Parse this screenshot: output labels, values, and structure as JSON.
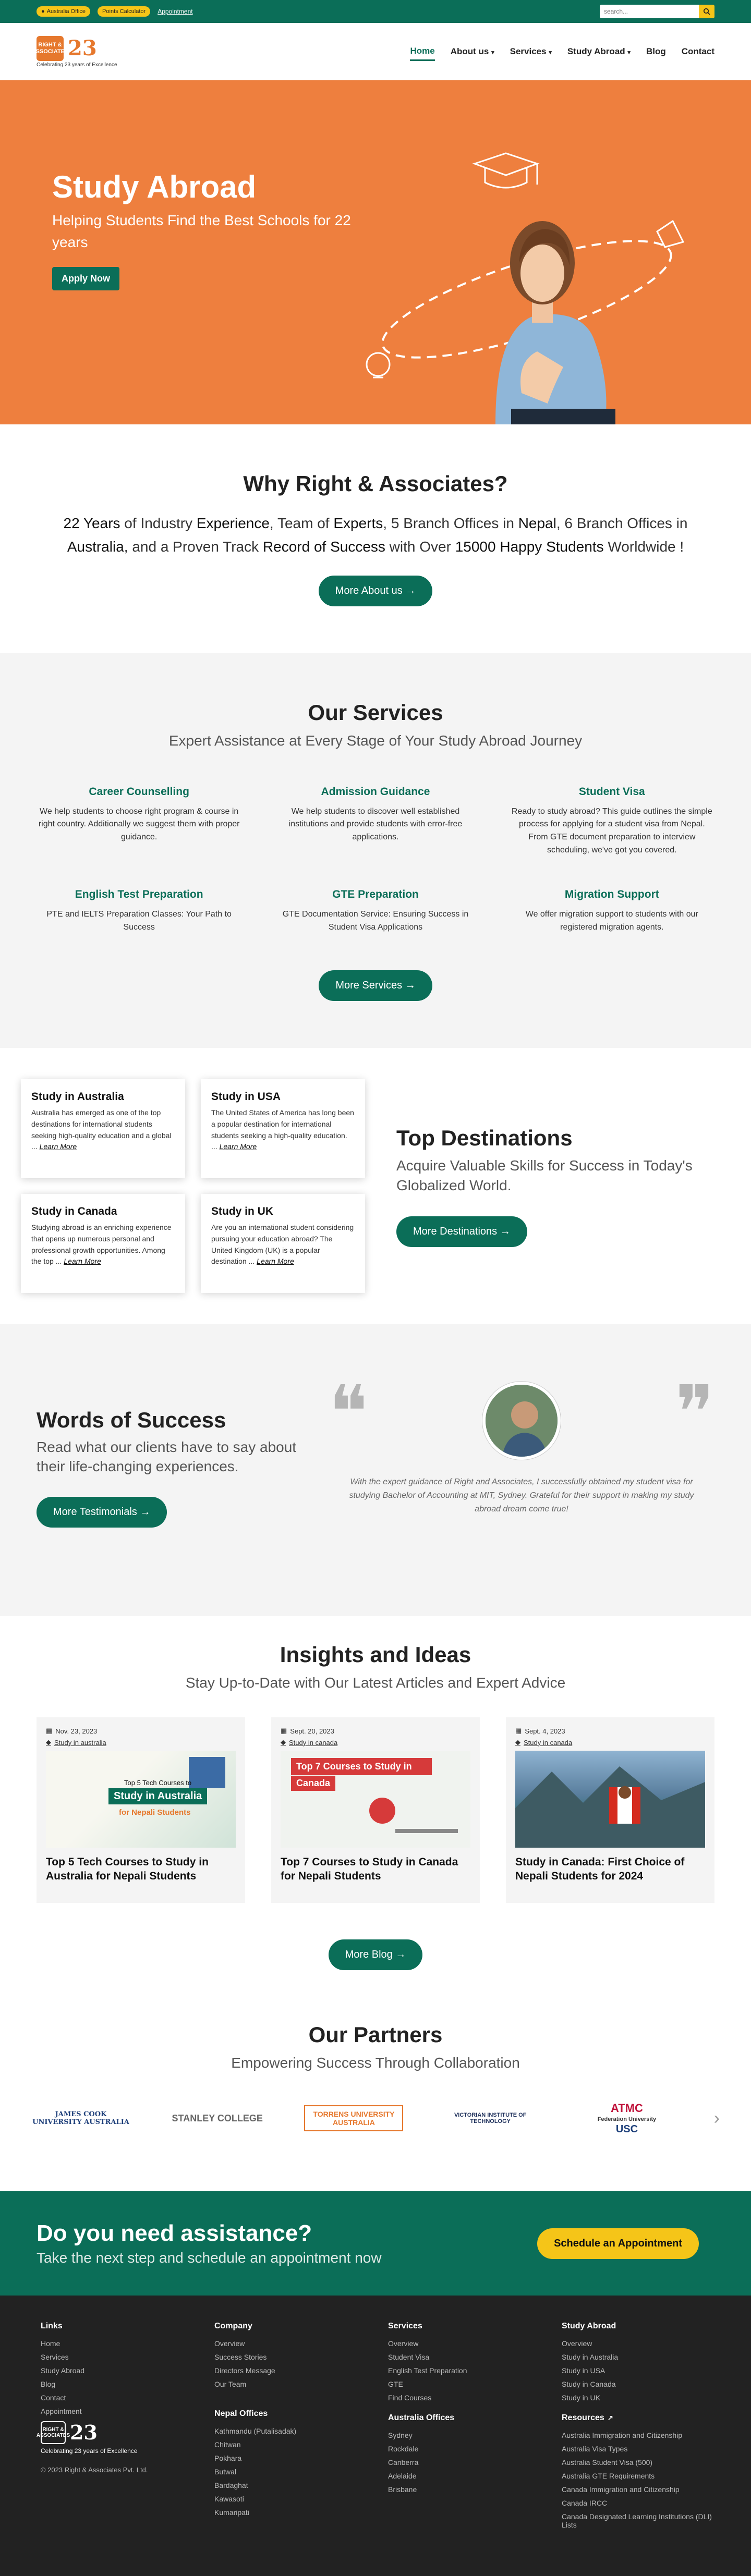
{
  "topbar": {
    "office_label": "Australia Office",
    "calculator_label": "Points Calculator",
    "appointment_label": "Appointment",
    "search_placeholder": "search..."
  },
  "brand": {
    "name": "RIGHT & ASSOCIATES",
    "years": "23",
    "tagline": "Celebrating 23 years of Excellence"
  },
  "nav": {
    "items": [
      "Home",
      "About us",
      "Services",
      "Study Abroad",
      "Blog",
      "Contact"
    ],
    "dropdown_indicators": [
      "",
      "▾",
      "▾",
      "▾",
      "",
      ""
    ]
  },
  "hero": {
    "title": "Study Abroad",
    "subtitle": "Helping Students Find the Best Schools for 22 years",
    "cta": "Apply Now"
  },
  "why": {
    "title": "Why Right & Associates?",
    "text_parts": [
      "22 Years",
      " of Industry ",
      "Experience",
      ", Team of ",
      "Experts",
      ", 5 Branch Offices in ",
      "Nepal",
      ", 6 Branch Offices in ",
      "Australia",
      ", and a Proven Track ",
      "Record of Success",
      " with Over ",
      "15000 Happy Students",
      " Worldwide !"
    ],
    "cta": "More About us"
  },
  "services": {
    "title": "Our Services",
    "subtitle": "Expert Assistance at Every Stage of Your Study Abroad Journey",
    "items": [
      {
        "title": "Career Counselling",
        "text": "We help students to choose right program & course in right country. Additionally we suggest them with proper guidance."
      },
      {
        "title": "Admission Guidance",
        "text": "We help students to discover well established institutions and provide students with error-free applications."
      },
      {
        "title": "Student Visa",
        "text": "Ready to study abroad? This guide outlines the simple process for applying for a student visa from Nepal. From GTE document preparation to interview scheduling, we've got you covered."
      },
      {
        "title": "English Test Preparation",
        "text": "PTE and IELTS Preparation Classes: Your Path to Success"
      },
      {
        "title": "GTE Preparation",
        "text": "GTE Documentation Service: Ensuring Success in Student Visa Applications"
      },
      {
        "title": "Migration Support",
        "text": "We offer migration support to students with our registered migration agents."
      }
    ],
    "cta": "More Services"
  },
  "destinations": {
    "title": "Top Destinations",
    "subtitle": "Acquire Valuable Skills for Success in Today's Globalized World.",
    "cta": "More Destinations",
    "learn_more": "Learn More",
    "cards": [
      {
        "title": "Study in Australia",
        "text": "Australia has emerged as one of the top destinations for international students seeking high-quality education and a global ..."
      },
      {
        "title": "Study in USA",
        "text": "The United States of America has long been a popular destination for international students seeking a high-quality education. ..."
      },
      {
        "title": "Study in Canada",
        "text": "Studying abroad is an enriching experience that opens up numerous personal and professional growth opportunities. Among the top ..."
      },
      {
        "title": "Study in UK",
        "text": "Are you an international student considering pursuing your education abroad? The United Kingdom (UK) is a popular destination ..."
      }
    ]
  },
  "testimonials": {
    "title": "Words of Success",
    "subtitle": "Read what our clients have to say about their life-changing experiences.",
    "cta": "More Testimonials",
    "quote": "With the expert guidance of Right and Associates, I successfully obtained my student visa for studying Bachelor of Accounting at MIT, Sydney. Grateful for their support in making my study abroad dream come true!"
  },
  "blog": {
    "title": "Insights and Ideas",
    "subtitle": "Stay Up-to-Date with Our Latest Articles and Expert Advice",
    "cta": "More Blog",
    "posts": [
      {
        "date": "Nov. 23, 2023",
        "tag": "Study in australia",
        "title": "Top 5 Tech Courses to Study in Australia for Nepali Students",
        "img_line1": "Top 5 Tech Courses to",
        "img_line2": "Study in Australia",
        "img_line3": "for Nepali Students"
      },
      {
        "date": "Sept. 20, 2023",
        "tag": "Study in canada",
        "title": "Top 7 Courses to Study in Canada for Nepali Students",
        "img_line1": "Top 7 Courses to Study in",
        "img_line2": "Canada"
      },
      {
        "date": "Sept. 4, 2023",
        "tag": "Study in canada",
        "title": "Study in Canada: First Choice of Nepali Students for 2024"
      }
    ]
  },
  "partners": {
    "title": "Our Partners",
    "subtitle": "Empowering Success Through Collaboration",
    "logos": [
      "JAMES COOK UNIVERSITY AUSTRALIA",
      "STANLEY COLLEGE",
      "TORRENS UNIVERSITY AUSTRALIA",
      "VICTORIAN INSTITUTE OF TECHNOLOGY",
      "ATMC",
      "Federation University",
      "USC"
    ]
  },
  "cta": {
    "title": "Do you need assistance?",
    "subtitle": "Take the next step and schedule an appointment now",
    "button": "Schedule an Appointment"
  },
  "footer": {
    "links": {
      "title": "Links",
      "items": [
        "Home",
        "Services",
        "Study Abroad",
        "Blog",
        "Contact",
        "Appointment"
      ]
    },
    "company": {
      "title": "Company",
      "items": [
        "Overview",
        "Success Stories",
        "Directors Message",
        "Our Team"
      ]
    },
    "services": {
      "title": "Services",
      "items": [
        "Overview",
        "Student Visa",
        "English Test Preparation",
        "GTE",
        "Find Courses"
      ]
    },
    "study_abroad": {
      "title": "Study Abroad",
      "items": [
        "Overview",
        "Study in Australia",
        "Study in USA",
        "Study in Canada",
        "Study in UK"
      ]
    },
    "nepal": {
      "title": "Nepal Offices",
      "items": [
        "Kathmandu (Putalisadak)",
        "Chitwan",
        "Pokhara",
        "Butwal",
        "Bardaghat",
        "Kawasoti",
        "Kumaripati"
      ]
    },
    "australia": {
      "title": "Australia Offices",
      "items": [
        "Sydney",
        "Rockdale",
        "Canberra",
        "Adelaide",
        "Brisbane"
      ]
    },
    "resources": {
      "title": "Resources",
      "items": [
        "Australia Immigration and Citizenship",
        "Australia Visa Types",
        "Australia Student Visa (500)",
        "Australia GTE Requirements",
        "Canada Immigration and Citizenship",
        "Canada IRCC",
        "Canada Designated Learning Institutions (DLI) Lists"
      ]
    },
    "copyright": "© 2023 Right & Associates Pvt. Ltd."
  },
  "colors": {
    "primary": "#0b6e58",
    "accent": "#f5c518",
    "hero": "#ee7f3e",
    "footer": "#222222"
  }
}
